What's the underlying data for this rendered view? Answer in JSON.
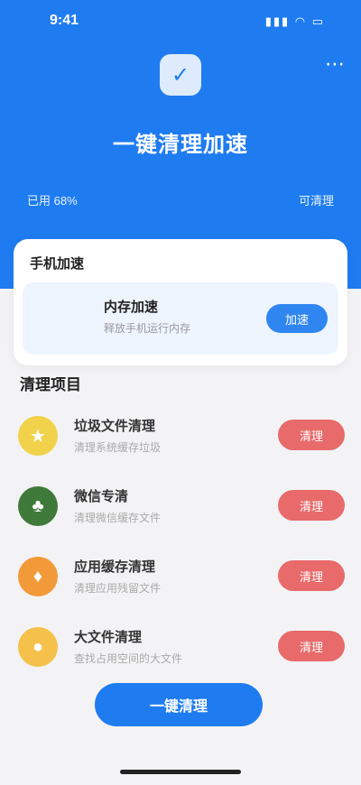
{
  "status_bar": {
    "time": "9:41",
    "icons": "▮▮▮ ◠ ▭"
  },
  "header": {
    "more_icon": "⋯",
    "logo_glyph": "✓",
    "title": "一键清理加速",
    "stat_left": "已用 68%",
    "stat_right": "可清理",
    "background": "#1f7cf0"
  },
  "card": {
    "title": "手机加速",
    "item_name": "内存加速",
    "item_sub": "释放手机运行内存",
    "button_label": "加速"
  },
  "section": {
    "title": "清理项目"
  },
  "list": [
    {
      "icon": "yellow-icon",
      "color": "#f2d24a",
      "glyph": "★",
      "name": "垃圾文件清理",
      "desc": "清理系统缓存垃圾",
      "button": "清理"
    },
    {
      "icon": "green-icon",
      "color": "#3f7a3a",
      "glyph": "♣",
      "name": "微信专清",
      "desc": "清理微信缓存文件",
      "button": "清理"
    },
    {
      "icon": "orange-icon",
      "color": "#f29a3a",
      "glyph": "♦",
      "name": "应用缓存清理",
      "desc": "清理应用残留文件",
      "button": "清理"
    },
    {
      "icon": "yellow-icon",
      "color": "#f5c14a",
      "glyph": "●",
      "name": "大文件清理",
      "desc": "查找占用空间的大文件",
      "button": "清理"
    }
  ],
  "main_button": {
    "label": "一键清理"
  },
  "colors": {
    "accent": "#1f7cf0",
    "danger": "#e86a6a",
    "background": "#f3f3f5"
  }
}
